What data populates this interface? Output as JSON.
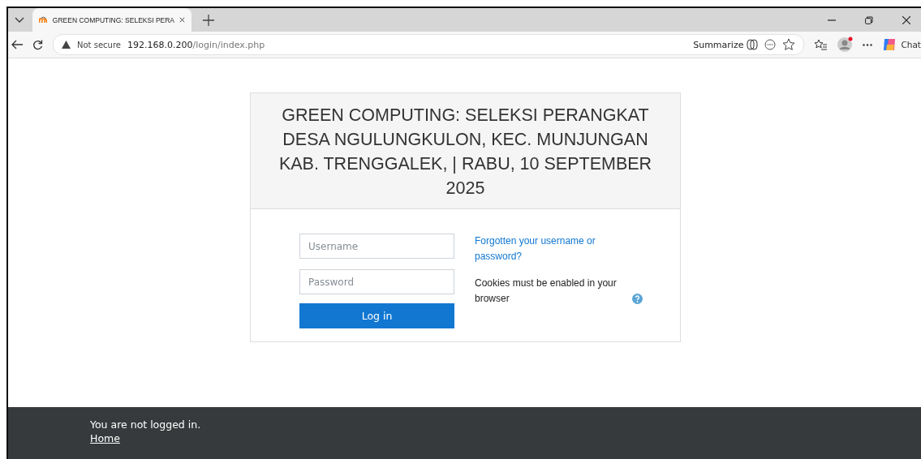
{
  "browser": {
    "tab": {
      "title": "GREEN COMPUTING: SELEKSI PERA",
      "selected": true
    },
    "address": {
      "security": "Not secure",
      "host": "192.168.0.200",
      "path": "/login/index.php"
    },
    "summarize": "Summarize",
    "chat": "Chat"
  },
  "login": {
    "heading": "GREEN COMPUTING: SELEKSI PERANGKAT DESA NGULUNGKULON, KEC. MUNJUNGAN KAB. TRENGGALEK, | RABU, 10 SEPTEMBER 2025",
    "username": {
      "placeholder": "Username"
    },
    "password": {
      "placeholder": "Password"
    },
    "button": "Log in",
    "forgot_link": "Forgotten your username or password?",
    "cookies_note": "Cookies must be enabled in your browser"
  },
  "footer": {
    "status": "You are not logged in.",
    "home_link": "Home"
  }
}
